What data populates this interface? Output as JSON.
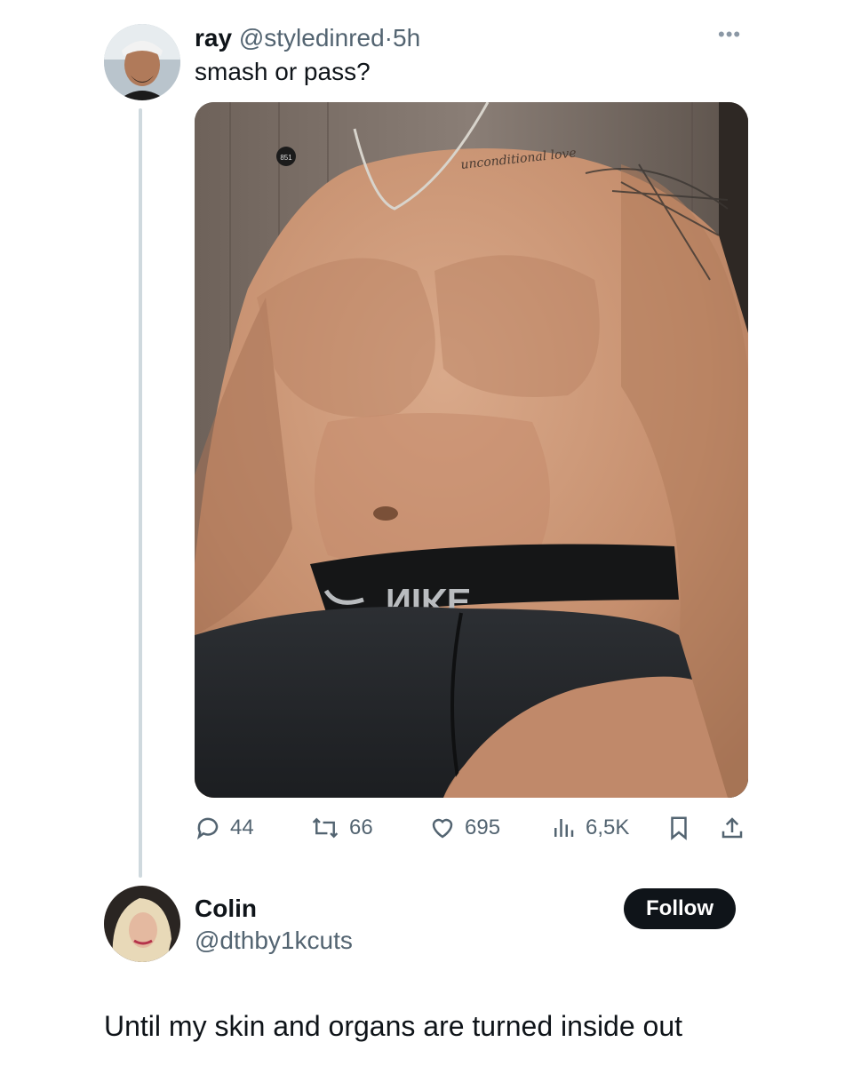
{
  "tweet": {
    "author_name": "ray",
    "author_handle": "@styledinred",
    "separator": "·",
    "time": "5h",
    "text": "smash or pass?",
    "more_icon": "more-dots-icon",
    "media": {
      "waistband_text": "NIKE",
      "necklace_tattoo_text": "unconditional love",
      "badge_text": "851"
    },
    "stats": {
      "replies": "44",
      "retweets": "66",
      "likes": "695",
      "views": "6,5K"
    },
    "icons": {
      "reply": "reply-bubble-icon",
      "retweet": "retweet-icon",
      "like": "heart-icon",
      "views": "views-bar-chart-icon",
      "bookmark": "bookmark-icon",
      "share": "share-upload-icon"
    }
  },
  "reply": {
    "author_name": "Colin",
    "author_handle": "@dthby1kcuts",
    "follow_label": "Follow",
    "text": "Until my skin and organs are turned inside out"
  },
  "colors": {
    "text_primary": "#0f1419",
    "text_secondary": "#536471",
    "thread_line": "#cfd9de",
    "follow_bg": "#0f1419"
  }
}
